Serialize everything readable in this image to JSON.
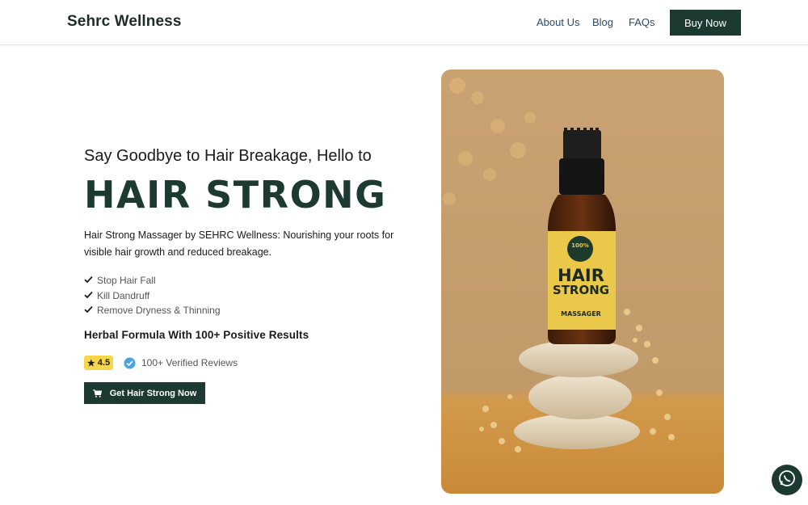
{
  "header": {
    "brand": "Sehrc Wellness",
    "nav": [
      "About Us",
      "Blog",
      "FAQs"
    ],
    "buy_label": "Buy Now"
  },
  "hero": {
    "subheading": "Say Goodbye to Hair Breakage, Hello to",
    "title": "HAIR STRONG",
    "description": "Hair Strong Massager by SEHRC Wellness: Nourishing your roots for visible hair growth and reduced breakage.",
    "features": [
      "Stop Hair Fall",
      "Kill Dandruff",
      "Remove Dryness & Thinning"
    ],
    "formula": "Herbal Formula With 100+ Positive Results",
    "rating": "4.5",
    "reviews": "100+ Verified Reviews",
    "cta_label": "Get Hair Strong Now"
  },
  "product_label": {
    "badge": "100%",
    "line1": "HAIR",
    "line2": "STRONG",
    "line3": "MASSAGER"
  },
  "colors": {
    "primary": "#1d3a32",
    "star_badge": "#f6d64a",
    "verified": "#4aa3df",
    "nav_link": "#2a4a6b"
  },
  "icons": {
    "check": "check-icon",
    "star": "star-icon",
    "verified": "verified-badge-icon",
    "cart": "cart-icon",
    "whatsapp": "whatsapp-icon"
  }
}
